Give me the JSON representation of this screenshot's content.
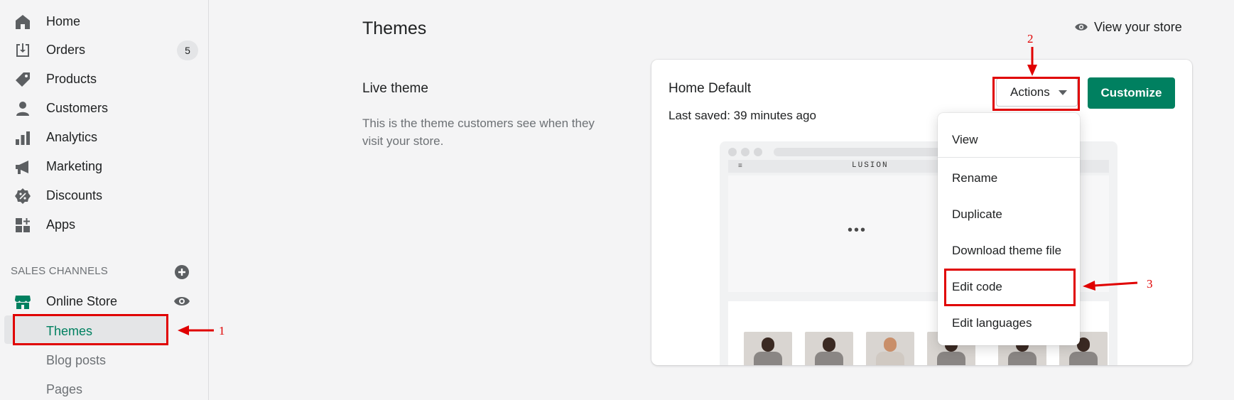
{
  "sidebar": {
    "nav": [
      {
        "label": "Home",
        "icon": "home-icon"
      },
      {
        "label": "Orders",
        "icon": "orders-icon",
        "badge": "5"
      },
      {
        "label": "Products",
        "icon": "tag-icon"
      },
      {
        "label": "Customers",
        "icon": "person-icon"
      },
      {
        "label": "Analytics",
        "icon": "bar-chart-icon"
      },
      {
        "label": "Marketing",
        "icon": "megaphone-icon"
      },
      {
        "label": "Discounts",
        "icon": "discount-icon"
      },
      {
        "label": "Apps",
        "icon": "apps-icon"
      }
    ],
    "sales_channels_label": "SALES CHANNELS",
    "online_store": {
      "label": "Online Store",
      "icon": "store-icon"
    },
    "sub_items": [
      "Themes",
      "Blog posts",
      "Pages"
    ]
  },
  "annotations": {
    "one": "1",
    "two": "2",
    "three": "3"
  },
  "main": {
    "title": "Themes",
    "view_store": "View your store",
    "live_theme": {
      "title": "Live theme",
      "description": "This is the theme customers see when they visit your store."
    },
    "card": {
      "theme_name": "Home Default",
      "last_saved": "Last saved: 39 minutes ago",
      "actions_label": "Actions",
      "customize_label": "Customize",
      "preview": {
        "brand": "LUSION",
        "menu": "≡",
        "loading": "•••"
      }
    },
    "dropdown": [
      "View",
      "Rename",
      "Duplicate",
      "Download theme file",
      "Edit code",
      "Edit languages"
    ]
  },
  "colors": {
    "accent": "#008060",
    "annotation_red": "#e00000"
  }
}
